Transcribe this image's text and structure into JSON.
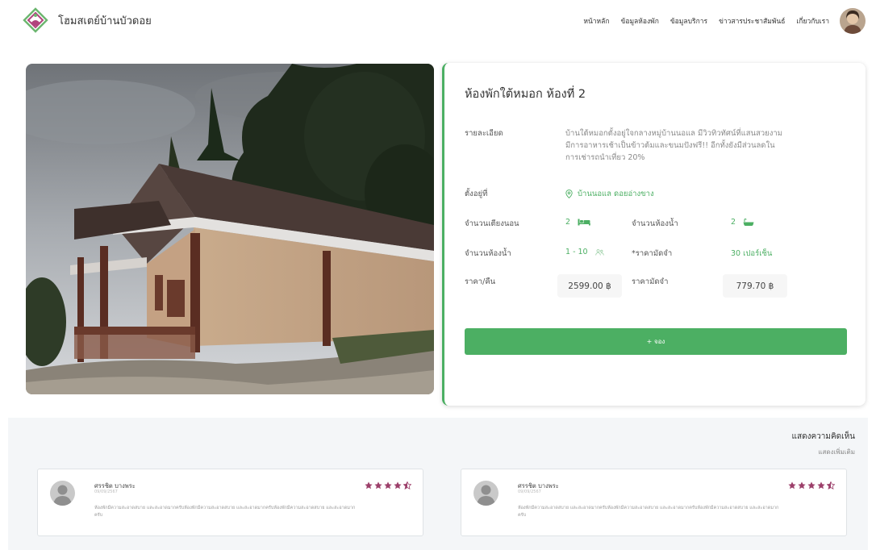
{
  "brand": {
    "name": "โฮมสเตย์บ้านบัวดอย"
  },
  "nav": {
    "links": [
      "หน้าหลัก",
      "ข้อมูลห้องพัก",
      "ข้อมูลบริการ",
      "ข่าวสารประชาสัมพันธ์",
      "เกี่ยวกับเรา"
    ]
  },
  "room": {
    "title": "ห้องพักใต้หมอก ห้องที่ 2",
    "detail_label": "รายละเอียด",
    "detail_text": "บ้านใต้หมอกตั้งอยู่ใจกลางหมู่บ้านนอแล มีวิวทิวทัศน์ที่แสนสวยงาม มีการอาหารเช้าเป็นข้าวต้มและขนมปังฟรี!! อีกทั้งยังมีส่วนลดในการเช่ารถนำเที่ยว 20%",
    "location_label": "ตั้งอยู่ที่",
    "location_value": "บ้านนอแล ดอยอ่างขาง",
    "beds_label": "จำนวนเตียงนอน",
    "beds_value": "2",
    "bath_label": "จำนวนห้องน้ำ",
    "bath_value": "2",
    "guests_label": "จำนวนห้องน้ำ",
    "guests_value": "1 - 10",
    "deposit_pct_label": "*ราคามัดจำ",
    "deposit_pct_value": "30 เปอร์เซ็น",
    "price_label": "ราคา/คืน",
    "price_value": "2599.00 ฿",
    "deposit_label": "ราคามัดจำ",
    "deposit_value": "779.70 ฿",
    "book_label": "+ จอง"
  },
  "reviews": {
    "title": "แสดงความคิดเห็น",
    "more": "แสดงเพิ่มเติม",
    "items": [
      {
        "name": "ศรรชิต บางพระ",
        "date": "09/09/2567",
        "rating": 4.5,
        "text": "ห้องพักมีความสะอาดสบาย และสะอาดมากครับห้องพักมีความสะอาดสบาย และสะอาดมากครับห้องพักมีความสะอาดสบาย และสะอาดมากครับ"
      },
      {
        "name": "ศรรชิต บางพระ",
        "date": "09/09/2567",
        "rating": 4.5,
        "text": "ห้องพักมีความสะอาดสบาย และสะอาดมากครับห้องพักมีความสะอาดสบาย และสะอาดมากครับห้องพักมีความสะอาดสบาย และสะอาดมากครับ"
      }
    ]
  },
  "colors": {
    "accent": "#4caf63",
    "star": "#9c3f6a",
    "muted": "#8a8a8a"
  },
  "icons": {
    "bed": "bed-icon",
    "bath": "bathtub-icon",
    "guests": "people-icon",
    "location": "map-pin-icon",
    "star": "star-icon"
  }
}
